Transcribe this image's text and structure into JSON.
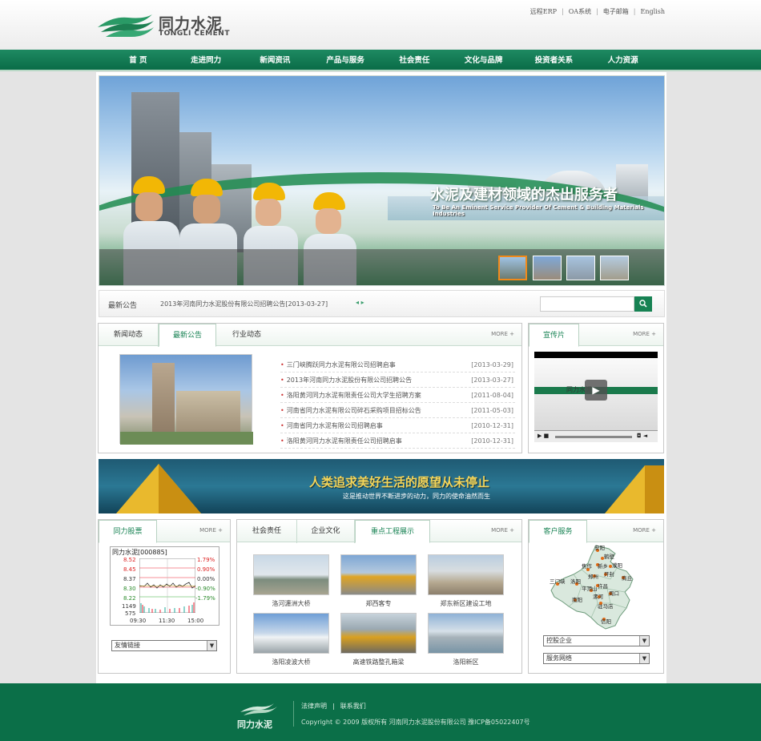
{
  "header": {
    "logo_cn": "同力水泥",
    "logo_en": "TONGLI CEMENT",
    "top_links": [
      "远程ERP",
      "OA系统",
      "电子邮箱",
      "English"
    ]
  },
  "nav": {
    "items": [
      "首 页",
      "走进同力",
      "新闻资讯",
      "产品与服务",
      "社会责任",
      "文化与品牌",
      "投资者关系",
      "人力资源"
    ]
  },
  "banner": {
    "title": "水泥及建材领域的杰出服务者",
    "subtitle": "To Be An Eminent Service Provider Of Cement & Building Materials Industries"
  },
  "notice": {
    "label": "最新公告",
    "text": "2013年河南同力水泥股份有限公司招聘公告[2013-03-27]",
    "search_placeholder": ""
  },
  "news": {
    "tabs": [
      "新闻动态",
      "最新公告",
      "行业动态"
    ],
    "more": "MORE +",
    "items": [
      {
        "title": "三门峡腾跃同力水泥有限公司招聘启事",
        "date": "[2013-03-29]"
      },
      {
        "title": "2013年河南同力水泥股份有限公司招聘公告",
        "date": "[2013-03-27]"
      },
      {
        "title": "洛阳黄河同力水泥有限责任公司大学生招聘方案",
        "date": "[2011-08-04]"
      },
      {
        "title": "河南省同力水泥有限公司碎石采购项目招标公告",
        "date": "[2011-05-03]"
      },
      {
        "title": "河南省同力水泥有限公司招聘启事",
        "date": "[2010-12-31]"
      },
      {
        "title": "洛阳黄河同力水泥有限责任公司招聘启事",
        "date": "[2010-12-31]"
      }
    ]
  },
  "video": {
    "tab": "宣传片",
    "more": "MORE +",
    "screen_text": "同力水泥"
  },
  "mid_banner": {
    "title": "人类追求美好生活的愿望从未停止",
    "subtitle": "这是推动世界不断进步的动力，同力的使命油然而生"
  },
  "stock": {
    "tab": "同力股票",
    "more": "MORE +",
    "name": "同力水泥[000885]",
    "left_labels": [
      "8.52",
      "8.45",
      "8.37",
      "8.30",
      "8.22",
      "1149",
      "575"
    ],
    "right_labels": [
      "1.79%",
      "0.90%",
      "0.00%",
      "-0.90%",
      "-1.79%"
    ],
    "time_labels": [
      "09:30",
      "11:30",
      "15:00"
    ],
    "link_select": "友情链接"
  },
  "projects": {
    "tabs": [
      "社会责任",
      "企业文化",
      "重点工程展示"
    ],
    "more": "MORE +",
    "items": [
      "洛河瀍洲大桥",
      "郑西客专",
      "郑东新区建设工地",
      "洛阳凌波大桥",
      "高速铁路整孔箱梁",
      "洛阳新区"
    ]
  },
  "service": {
    "tab": "客户服务",
    "more": "MORE +",
    "select1": "控股企业",
    "select2": "服务网络",
    "map_cities": [
      "安阳",
      "鹤壁",
      "新乡",
      "濮阳",
      "焦作",
      "三门峡",
      "郑州",
      "开封",
      "洛阳",
      "许昌",
      "平顶山",
      "周口",
      "南阳",
      "驻马店",
      "信阳",
      "商丘",
      "漯河"
    ]
  },
  "footer": {
    "logo_text": "同力水泥",
    "links": [
      "法律声明",
      "联系我们"
    ],
    "copyright": "Copyright © 2009 版权所有 河南同力水泥股份有限公司 豫ICP备05022407号"
  },
  "colors": {
    "brand_green": "#0b6f48",
    "accent_green": "#178253",
    "gold": "#f5d65a"
  }
}
